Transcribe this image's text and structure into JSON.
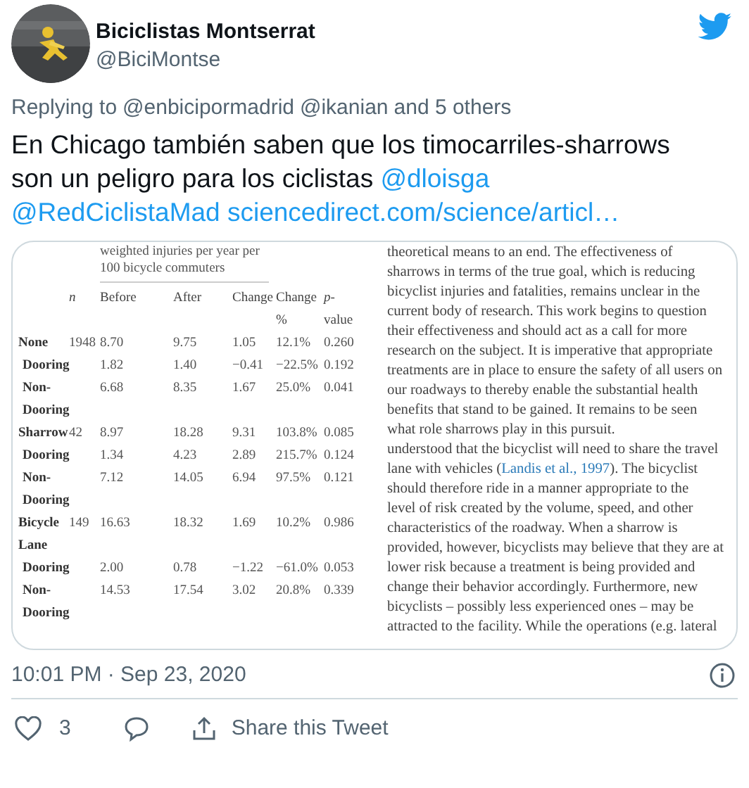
{
  "author": {
    "name": "Biciclistas Montserrat",
    "handle": "@BiciMontse"
  },
  "replying_to": {
    "prefix": "Replying to",
    "mentions": [
      "@enbicipormadrid",
      "@ikanian"
    ],
    "rest": "and 5 others"
  },
  "tweet_text": [
    {
      "kind": "text",
      "text": "En Chicago también saben que los timocarriles-sharrows son un peligro para los ciclistas"
    },
    {
      "kind": "mention",
      "text": "@dloisga"
    },
    {
      "kind": "mention",
      "text": "@RedCiclistaMad"
    },
    {
      "kind": "link",
      "text": "sciencedirect.com/science/articl…"
    }
  ],
  "document": {
    "table": {
      "group_header": "weighted injuries per year per 100 bicycle commuters",
      "columns": [
        "",
        "*n*",
        "Before",
        "After",
        "Change",
        "Change %",
        "*p*-value"
      ],
      "rows": [
        {
          "kind": "main",
          "cells": [
            "None",
            "1948",
            "8.70",
            "9.75",
            "1.05",
            "12.1%",
            "0.260"
          ]
        },
        {
          "kind": "sub",
          "cells": [
            "Dooring",
            "",
            "1.82",
            "1.40",
            "−0.41",
            "−22.5%",
            "0.192"
          ]
        },
        {
          "kind": "sub",
          "cells": [
            "Non-Dooring",
            "",
            "6.68",
            "8.35",
            "1.67",
            "25.0%",
            "0.041"
          ]
        },
        {
          "kind": "main",
          "cells": [
            "Sharrow",
            "42",
            "8.97",
            "18.28",
            "9.31",
            "103.8%",
            "0.085"
          ]
        },
        {
          "kind": "sub",
          "cells": [
            "Dooring",
            "",
            "1.34",
            "4.23",
            "2.89",
            "215.7%",
            "0.124"
          ]
        },
        {
          "kind": "sub",
          "cells": [
            "Non-Dooring",
            "",
            "7.12",
            "14.05",
            "6.94",
            "97.5%",
            "0.121"
          ]
        },
        {
          "kind": "main",
          "cells": [
            "Bicycle Lane",
            "149",
            "16.63",
            "18.32",
            "1.69",
            "10.2%",
            "0.986"
          ]
        },
        {
          "kind": "sub",
          "cells": [
            "Dooring",
            "",
            "2.00",
            "0.78",
            "−1.22",
            "−61.0%",
            "0.053"
          ]
        },
        {
          "kind": "sub",
          "cells": [
            "Non-Dooring",
            "",
            "14.53",
            "17.54",
            "3.02",
            "20.8%",
            "0.339"
          ]
        }
      ]
    },
    "paragraphs": [
      [
        [
          {
            "kind": "text",
            "text": "theoretical means to an end. The effectiveness of"
          }
        ],
        [
          {
            "kind": "text",
            "text": "sharrows in terms of the true goal, which is reducing"
          }
        ],
        [
          {
            "kind": "text",
            "text": "bicyclist injuries and fatalities, remains unclear in the"
          }
        ],
        [
          {
            "kind": "text",
            "text": "current body of research. This work begins to question"
          }
        ],
        [
          {
            "kind": "text",
            "text": "their effectiveness and should act as a call for more"
          }
        ],
        [
          {
            "kind": "text",
            "text": "research on the subject. It is imperative that appropriate"
          }
        ],
        [
          {
            "kind": "text",
            "text": "treatments are in place to ensure the safety of all users on"
          }
        ],
        [
          {
            "kind": "text",
            "text": "our roadways to thereby enable the substantial health"
          }
        ],
        [
          {
            "kind": "text",
            "text": "benefits that stand to be gained. It remains to be seen"
          }
        ],
        [
          {
            "kind": "text",
            "text": "what role sharrows play in this pursuit."
          }
        ]
      ],
      [
        [
          {
            "kind": "text",
            "text": "understood that the bicyclist will need to share the travel"
          }
        ],
        [
          {
            "kind": "text",
            "text": "lane with vehicles ("
          },
          {
            "kind": "link",
            "text": "Landis et al., 1997"
          },
          {
            "kind": "text",
            "text": "). The bicyclist"
          }
        ],
        [
          {
            "kind": "text",
            "text": "should therefore ride in a manner appropriate to the"
          }
        ],
        [
          {
            "kind": "text",
            "text": "level of risk created by the volume, speed, and other"
          }
        ],
        [
          {
            "kind": "text",
            "text": "characteristics of the roadway. When a sharrow is"
          }
        ],
        [
          {
            "kind": "text",
            "text": "provided, however, bicyclists may believe that they are at"
          }
        ],
        [
          {
            "kind": "text",
            "text": "lower risk because a treatment is being provided and"
          }
        ],
        [
          {
            "kind": "text",
            "text": "change their behavior accordingly. Furthermore, new"
          }
        ],
        [
          {
            "kind": "text",
            "text": "bicyclists – possibly less experienced ones – may be"
          }
        ],
        [
          {
            "kind": "text",
            "text": "attracted to the facility. While the operations (e.g. lateral"
          }
        ]
      ]
    ]
  },
  "timestamp": "10:01 PM · Sep 23, 2020",
  "actions": {
    "likes": "3",
    "share": "Share this Tweet"
  }
}
